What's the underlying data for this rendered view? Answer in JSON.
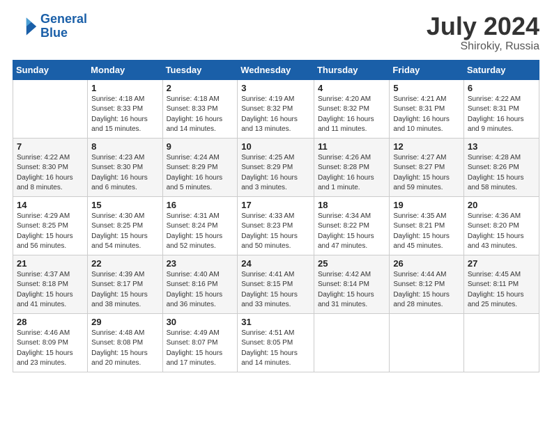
{
  "header": {
    "logo_line1": "General",
    "logo_line2": "Blue",
    "month": "July 2024",
    "location": "Shirokiy, Russia"
  },
  "weekdays": [
    "Sunday",
    "Monday",
    "Tuesday",
    "Wednesday",
    "Thursday",
    "Friday",
    "Saturday"
  ],
  "weeks": [
    [
      {
        "day": "",
        "sunrise": "",
        "sunset": "",
        "daylight": ""
      },
      {
        "day": "1",
        "sunrise": "Sunrise: 4:18 AM",
        "sunset": "Sunset: 8:33 PM",
        "daylight": "Daylight: 16 hours and 15 minutes."
      },
      {
        "day": "2",
        "sunrise": "Sunrise: 4:18 AM",
        "sunset": "Sunset: 8:33 PM",
        "daylight": "Daylight: 16 hours and 14 minutes."
      },
      {
        "day": "3",
        "sunrise": "Sunrise: 4:19 AM",
        "sunset": "Sunset: 8:32 PM",
        "daylight": "Daylight: 16 hours and 13 minutes."
      },
      {
        "day": "4",
        "sunrise": "Sunrise: 4:20 AM",
        "sunset": "Sunset: 8:32 PM",
        "daylight": "Daylight: 16 hours and 11 minutes."
      },
      {
        "day": "5",
        "sunrise": "Sunrise: 4:21 AM",
        "sunset": "Sunset: 8:31 PM",
        "daylight": "Daylight: 16 hours and 10 minutes."
      },
      {
        "day": "6",
        "sunrise": "Sunrise: 4:22 AM",
        "sunset": "Sunset: 8:31 PM",
        "daylight": "Daylight: 16 hours and 9 minutes."
      }
    ],
    [
      {
        "day": "7",
        "sunrise": "Sunrise: 4:22 AM",
        "sunset": "Sunset: 8:30 PM",
        "daylight": "Daylight: 16 hours and 8 minutes."
      },
      {
        "day": "8",
        "sunrise": "Sunrise: 4:23 AM",
        "sunset": "Sunset: 8:30 PM",
        "daylight": "Daylight: 16 hours and 6 minutes."
      },
      {
        "day": "9",
        "sunrise": "Sunrise: 4:24 AM",
        "sunset": "Sunset: 8:29 PM",
        "daylight": "Daylight: 16 hours and 5 minutes."
      },
      {
        "day": "10",
        "sunrise": "Sunrise: 4:25 AM",
        "sunset": "Sunset: 8:29 PM",
        "daylight": "Daylight: 16 hours and 3 minutes."
      },
      {
        "day": "11",
        "sunrise": "Sunrise: 4:26 AM",
        "sunset": "Sunset: 8:28 PM",
        "daylight": "Daylight: 16 hours and 1 minute."
      },
      {
        "day": "12",
        "sunrise": "Sunrise: 4:27 AM",
        "sunset": "Sunset: 8:27 PM",
        "daylight": "Daylight: 15 hours and 59 minutes."
      },
      {
        "day": "13",
        "sunrise": "Sunrise: 4:28 AM",
        "sunset": "Sunset: 8:26 PM",
        "daylight": "Daylight: 15 hours and 58 minutes."
      }
    ],
    [
      {
        "day": "14",
        "sunrise": "Sunrise: 4:29 AM",
        "sunset": "Sunset: 8:25 PM",
        "daylight": "Daylight: 15 hours and 56 minutes."
      },
      {
        "day": "15",
        "sunrise": "Sunrise: 4:30 AM",
        "sunset": "Sunset: 8:25 PM",
        "daylight": "Daylight: 15 hours and 54 minutes."
      },
      {
        "day": "16",
        "sunrise": "Sunrise: 4:31 AM",
        "sunset": "Sunset: 8:24 PM",
        "daylight": "Daylight: 15 hours and 52 minutes."
      },
      {
        "day": "17",
        "sunrise": "Sunrise: 4:33 AM",
        "sunset": "Sunset: 8:23 PM",
        "daylight": "Daylight: 15 hours and 50 minutes."
      },
      {
        "day": "18",
        "sunrise": "Sunrise: 4:34 AM",
        "sunset": "Sunset: 8:22 PM",
        "daylight": "Daylight: 15 hours and 47 minutes."
      },
      {
        "day": "19",
        "sunrise": "Sunrise: 4:35 AM",
        "sunset": "Sunset: 8:21 PM",
        "daylight": "Daylight: 15 hours and 45 minutes."
      },
      {
        "day": "20",
        "sunrise": "Sunrise: 4:36 AM",
        "sunset": "Sunset: 8:20 PM",
        "daylight": "Daylight: 15 hours and 43 minutes."
      }
    ],
    [
      {
        "day": "21",
        "sunrise": "Sunrise: 4:37 AM",
        "sunset": "Sunset: 8:18 PM",
        "daylight": "Daylight: 15 hours and 41 minutes."
      },
      {
        "day": "22",
        "sunrise": "Sunrise: 4:39 AM",
        "sunset": "Sunset: 8:17 PM",
        "daylight": "Daylight: 15 hours and 38 minutes."
      },
      {
        "day": "23",
        "sunrise": "Sunrise: 4:40 AM",
        "sunset": "Sunset: 8:16 PM",
        "daylight": "Daylight: 15 hours and 36 minutes."
      },
      {
        "day": "24",
        "sunrise": "Sunrise: 4:41 AM",
        "sunset": "Sunset: 8:15 PM",
        "daylight": "Daylight: 15 hours and 33 minutes."
      },
      {
        "day": "25",
        "sunrise": "Sunrise: 4:42 AM",
        "sunset": "Sunset: 8:14 PM",
        "daylight": "Daylight: 15 hours and 31 minutes."
      },
      {
        "day": "26",
        "sunrise": "Sunrise: 4:44 AM",
        "sunset": "Sunset: 8:12 PM",
        "daylight": "Daylight: 15 hours and 28 minutes."
      },
      {
        "day": "27",
        "sunrise": "Sunrise: 4:45 AM",
        "sunset": "Sunset: 8:11 PM",
        "daylight": "Daylight: 15 hours and 25 minutes."
      }
    ],
    [
      {
        "day": "28",
        "sunrise": "Sunrise: 4:46 AM",
        "sunset": "Sunset: 8:09 PM",
        "daylight": "Daylight: 15 hours and 23 minutes."
      },
      {
        "day": "29",
        "sunrise": "Sunrise: 4:48 AM",
        "sunset": "Sunset: 8:08 PM",
        "daylight": "Daylight: 15 hours and 20 minutes."
      },
      {
        "day": "30",
        "sunrise": "Sunrise: 4:49 AM",
        "sunset": "Sunset: 8:07 PM",
        "daylight": "Daylight: 15 hours and 17 minutes."
      },
      {
        "day": "31",
        "sunrise": "Sunrise: 4:51 AM",
        "sunset": "Sunset: 8:05 PM",
        "daylight": "Daylight: 15 hours and 14 minutes."
      },
      {
        "day": "",
        "sunrise": "",
        "sunset": "",
        "daylight": ""
      },
      {
        "day": "",
        "sunrise": "",
        "sunset": "",
        "daylight": ""
      },
      {
        "day": "",
        "sunrise": "",
        "sunset": "",
        "daylight": ""
      }
    ]
  ]
}
